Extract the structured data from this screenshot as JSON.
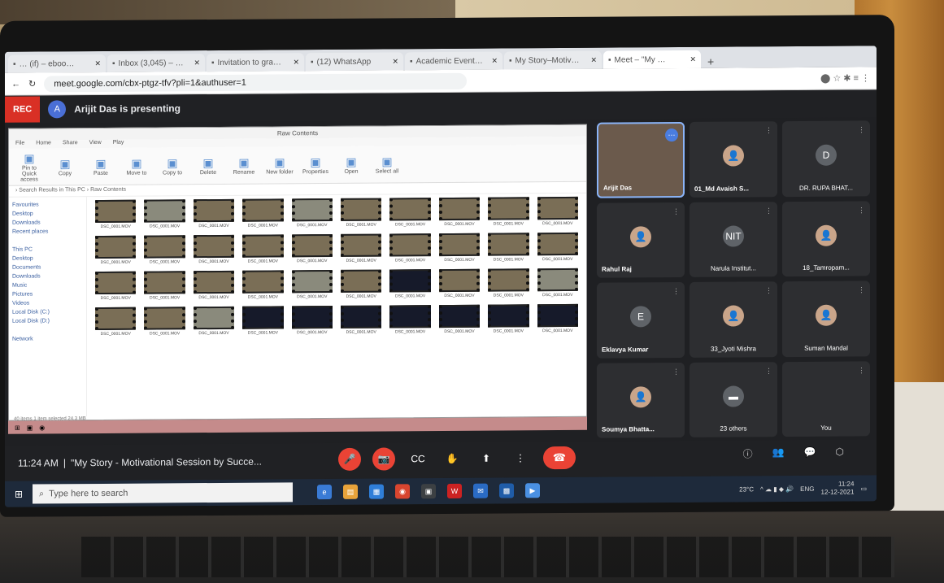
{
  "browser": {
    "tabs": [
      {
        "label": "… (if) – eboo…",
        "icon": "page-icon"
      },
      {
        "label": "Inbox (3,045) – …",
        "icon": "gmail-icon"
      },
      {
        "label": "Invitation to gra…",
        "icon": "gmail-icon"
      },
      {
        "label": "(12) WhatsApp",
        "icon": "whatsapp-icon"
      },
      {
        "label": "Academic Event…",
        "icon": "calendar-icon"
      },
      {
        "label": "My Story–Motiv…",
        "icon": "youtube-icon"
      },
      {
        "label": "Meet – \"My …",
        "icon": "meet-icon",
        "active": true
      }
    ],
    "url": "meet.google.com/cbx-ptgz-tfv?pli=1&authuser=1"
  },
  "meet": {
    "rec_label": "REC",
    "presenter_initial": "A",
    "presenting_text": "Arijit Das is presenting",
    "clock": "11:24 AM",
    "separator": "|",
    "meeting_name": "\"My Story - Motivational Session by Succe...",
    "participants": [
      {
        "name": "Arijit Das",
        "avatar": "",
        "active": true
      },
      {
        "name": "01_Md Avaish S...",
        "avatar": "👤"
      },
      {
        "name": "DR. RUPA BHAT...",
        "avatar": "D",
        "center": true
      },
      {
        "name": "Rahul Raj",
        "avatar": "👤"
      },
      {
        "name": "Narula Institut...",
        "avatar": "NIT",
        "center": true
      },
      {
        "name": "18_Tamropam...",
        "avatar": "👤",
        "center": true
      },
      {
        "name": "Eklavya Kumar",
        "avatar": "E"
      },
      {
        "name": "33_Jyoti Mishra",
        "avatar": "👤",
        "center": true
      },
      {
        "name": "Suman Mandal",
        "avatar": "👤",
        "center": true
      },
      {
        "name": "Soumya Bhatta...",
        "avatar": "👤"
      },
      {
        "name": "23 others",
        "avatar": "▬",
        "center": true
      },
      {
        "name": "You",
        "avatar": "",
        "center": true
      }
    ]
  },
  "explorer": {
    "title": "Raw Contents",
    "ribbon_tabs": [
      "File",
      "Home",
      "Share",
      "View",
      "Play"
    ],
    "ribbon_buttons": [
      "Pin to Quick access",
      "Copy",
      "Paste",
      "Move to",
      "Copy to",
      "Delete",
      "Rename",
      "New folder",
      "Properties",
      "Open",
      "Select all"
    ],
    "breadcrumb": "› Search Results in This PC › Raw Contents",
    "nav": [
      "Favourites",
      "Desktop",
      "Downloads",
      "Recent places",
      "",
      "This PC",
      "Desktop",
      "Documents",
      "Downloads",
      "Music",
      "Pictures",
      "Videos",
      "Local Disk (C:)",
      "Local Disk (D:)",
      "",
      "Network"
    ],
    "column_caption": "DSC_0001.MOV",
    "thumbnails": [
      "m",
      "g",
      "m",
      "m",
      "g",
      "m",
      "m",
      "m",
      "m",
      "m",
      "m",
      "m",
      "m",
      "m",
      "m",
      "m",
      "m",
      "m",
      "m",
      "m",
      "m",
      "m",
      "m",
      "m",
      "g",
      "m",
      "d",
      "m",
      "m",
      "g",
      "m",
      "m",
      "g",
      "d",
      "d",
      "d",
      "d",
      "d",
      "d",
      "d"
    ],
    "status": "40 items   1 item selected  24.3 MB"
  },
  "controls": {
    "mic": "🎤",
    "cam": "📷",
    "captions": "CC",
    "hand": "✋",
    "present": "⬆",
    "more": "⋮",
    "hangup": "☎",
    "info": "ⓘ",
    "people": "👥",
    "chat": "💬",
    "activities": "⬡"
  },
  "taskbar": {
    "search_placeholder": "Type here to search",
    "weather": "23°C",
    "lang": "ENG",
    "time": "11:24",
    "date": "12-12-2021"
  }
}
